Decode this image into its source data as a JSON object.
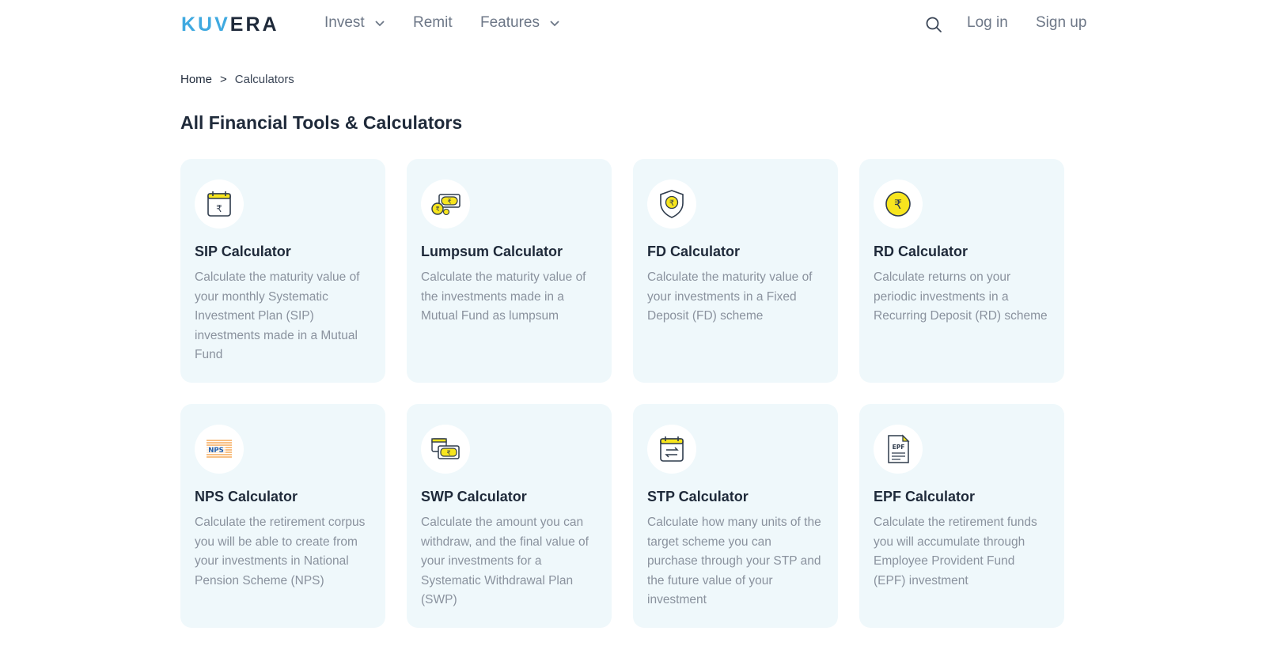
{
  "brand": {
    "part1": "KUV",
    "part2": "ERA"
  },
  "nav": {
    "invest": "Invest",
    "remit": "Remit",
    "features": "Features",
    "login": "Log in",
    "signup": "Sign up"
  },
  "breadcrumb": {
    "home": "Home",
    "sep": ">",
    "current": "Calculators"
  },
  "page_title": "All Financial Tools & Calculators",
  "cards": [
    {
      "icon": "calendar-rupee-icon",
      "title": "SIP Calculator",
      "desc": "Calculate the maturity value of your monthly Systematic Investment Plan (SIP) investments made in a Mutual Fund"
    },
    {
      "icon": "coins-banknote-icon",
      "title": "Lumpsum Calculator",
      "desc": "Calculate the maturity value of the investments made in a Mutual Fund as lumpsum"
    },
    {
      "icon": "shield-rupee-icon",
      "title": "FD Calculator",
      "desc": "Calculate the maturity value of your investments in a Fixed Deposit (FD) scheme"
    },
    {
      "icon": "rupee-coin-icon",
      "title": "RD Calculator",
      "desc": "Calculate returns on your periodic investments in a Recurring Deposit (RD) scheme"
    },
    {
      "icon": "nps-trust-logo-icon",
      "title": "NPS Calculator",
      "desc": "Calculate the retirement corpus you will be able to create from your investments in National Pension Scheme (NPS)"
    },
    {
      "icon": "calendar-banknote-icon",
      "title": "SWP Calculator",
      "desc": "Calculate the amount you can withdraw, and the final value of your investments for a Systematic Withdrawal Plan (SWP)"
    },
    {
      "icon": "calendar-transfer-icon",
      "title": "STP Calculator",
      "desc": "Calculate how many units of the target scheme you can purchase through your STP and the future value of your investment"
    },
    {
      "icon": "epf-document-icon",
      "title": "EPF Calculator",
      "desc": "Calculate the retirement funds you will accumulate through Employee Provident Fund (EPF) investment",
      "doc_label": "EPF"
    }
  ],
  "colors": {
    "accent": "#3fa9e0",
    "card_bg": "#eff8fb",
    "icon_yellow": "#f7e51e",
    "text_dark": "#1f2a3a",
    "text_muted": "#8a929e"
  }
}
